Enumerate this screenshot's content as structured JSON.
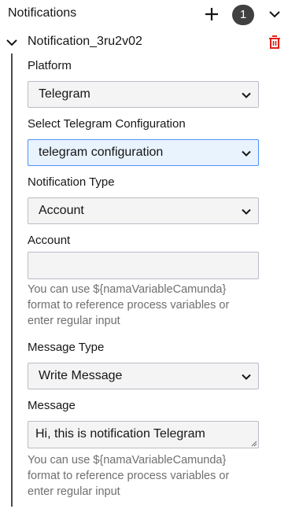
{
  "header": {
    "title": "Notifications",
    "count": "1",
    "add_icon": "plus-icon",
    "collapse_icon": "chevron-down-icon"
  },
  "entry": {
    "name": "Notification_3ru2v02",
    "expand_icon": "chevron-down-icon",
    "delete_icon": "trash-icon",
    "delete_color": "#e0201b"
  },
  "fields": {
    "platform": {
      "label": "Platform",
      "value": "Telegram"
    },
    "telegram_config": {
      "label": "Select Telegram Configuration",
      "value": "telegram configuration"
    },
    "notification_type": {
      "label": "Notification Type",
      "value": "Account"
    },
    "account": {
      "label": "Account",
      "value": "",
      "help_lines": [
        "You can use ${namaVariableCamunda}",
        "format to reference process variables or",
        "enter regular input"
      ]
    },
    "message_type": {
      "label": "Message Type",
      "value": "Write Message"
    },
    "message": {
      "label": "Message",
      "value": "Hi, this is notification Telegram",
      "help_lines": [
        "You can use ${namaVariableCamunda}",
        "format to reference process variables or",
        "enter regular input"
      ]
    }
  },
  "colors": {
    "focus_background": "#e9f3fd",
    "focus_border": "#4d90fe",
    "badge": "#404040"
  }
}
